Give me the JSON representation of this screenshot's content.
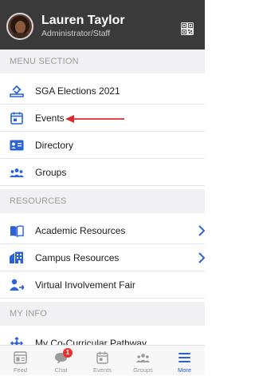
{
  "user": {
    "name": "Lauren Taylor",
    "role": "Administrator/Staff"
  },
  "sections": {
    "menu": "MENU SECTION",
    "resources": "RESOURCES",
    "my_info": "MY INFO"
  },
  "menu_items": [
    {
      "label": "SGA Elections 2021",
      "icon": "ballot-icon"
    },
    {
      "label": "Events",
      "icon": "calendar-icon"
    },
    {
      "label": "Directory",
      "icon": "contact-card-icon"
    },
    {
      "label": "Groups",
      "icon": "people-icon"
    }
  ],
  "resource_items": [
    {
      "label": "Academic Resources",
      "icon": "book-icon"
    },
    {
      "label": "Campus Resources",
      "icon": "building-icon"
    },
    {
      "label": "Virtual Involvement Fair",
      "icon": "person-plus-icon"
    }
  ],
  "info_items": [
    {
      "label": "My Co-Curricular Pathway",
      "icon": "pathway-icon"
    }
  ],
  "tabs": [
    {
      "label": "Feed",
      "icon": "feed-icon"
    },
    {
      "label": "Chat",
      "icon": "chat-icon",
      "badge": "1"
    },
    {
      "label": "Events",
      "icon": "calendar-icon"
    },
    {
      "label": "Groups",
      "icon": "people-icon"
    },
    {
      "label": "More",
      "icon": "menu-icon",
      "active": true
    }
  ],
  "colors": {
    "accent": "#2a62d8",
    "header_bg": "#3a3a3a",
    "annotation_arrow": "#d92b2b",
    "badge": "#e8322c"
  }
}
